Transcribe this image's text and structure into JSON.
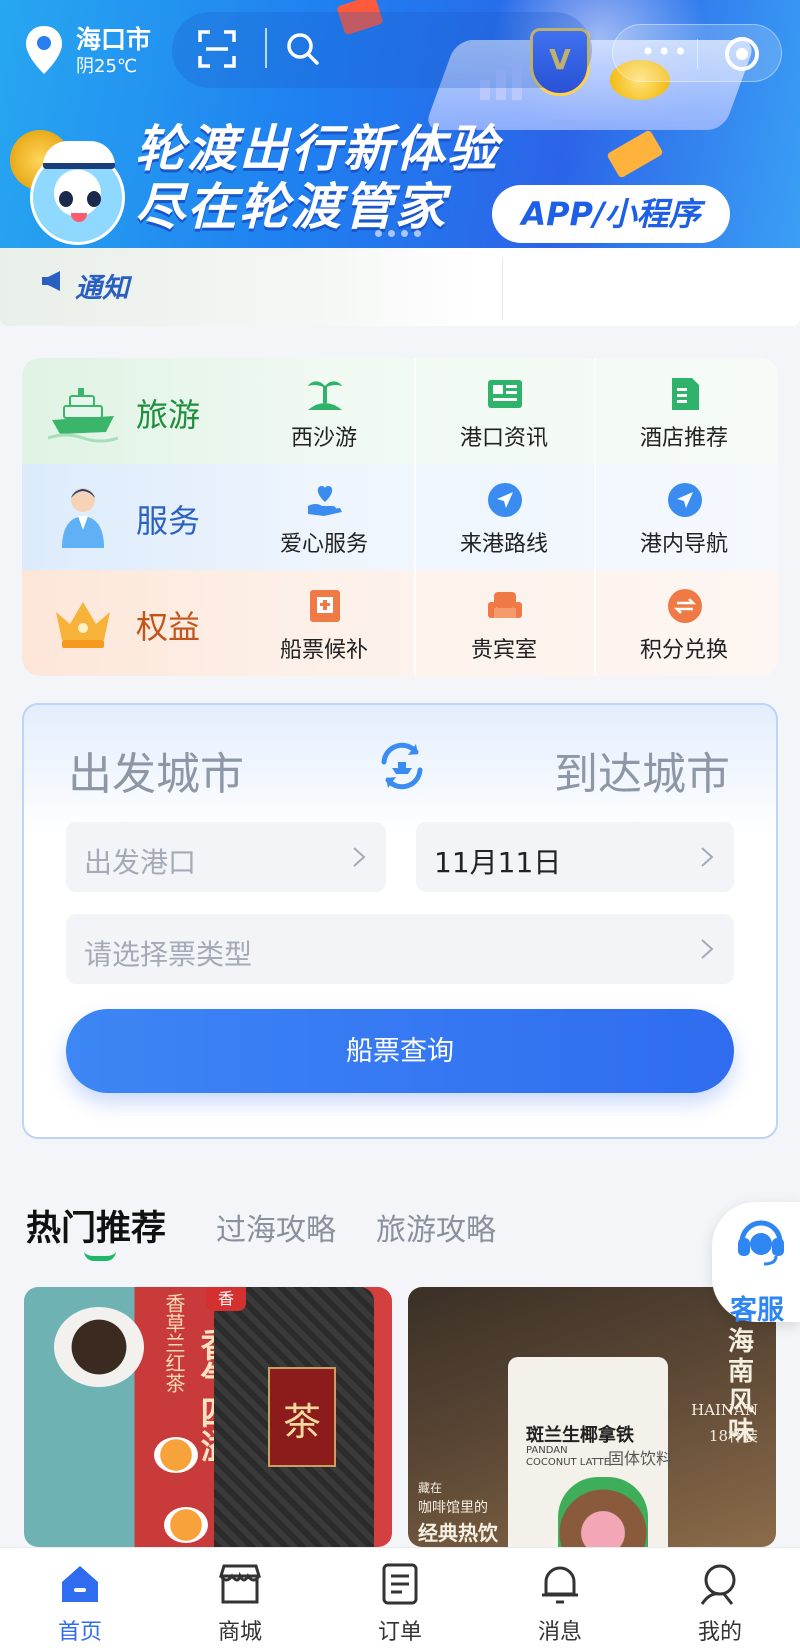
{
  "location": {
    "city": "海口市",
    "weather": "阴25℃"
  },
  "banner": {
    "headline_line1": "轮渡出行新体验",
    "headline_line2": "尽在轮渡管家",
    "pill": "APP/小程序",
    "shield_letter": "V"
  },
  "notice": {
    "label": "通知"
  },
  "categories": [
    {
      "title": "旅游",
      "items": [
        {
          "label": "西沙游",
          "icon": "palm-island-icon"
        },
        {
          "label": "港口资讯",
          "icon": "newspaper-icon"
        },
        {
          "label": "酒店推荐",
          "icon": "document-icon"
        }
      ]
    },
    {
      "title": "服务",
      "items": [
        {
          "label": "爱心服务",
          "icon": "heart-hand-icon"
        },
        {
          "label": "来港路线",
          "icon": "navigation-arrow-icon"
        },
        {
          "label": "港内导航",
          "icon": "navigation-arrow-icon"
        }
      ]
    },
    {
      "title": "权益",
      "items": [
        {
          "label": "船票候补",
          "icon": "ticket-waitlist-icon"
        },
        {
          "label": "贵宾室",
          "icon": "sofa-icon"
        },
        {
          "label": "积分兑换",
          "icon": "exchange-icon"
        }
      ]
    }
  ],
  "booking": {
    "from_city": "出发城市",
    "to_city": "到达城市",
    "port_placeholder": "出发港口",
    "date_value": "11月11日",
    "ticket_type_placeholder": "请选择票类型",
    "query_button": "船票查询"
  },
  "tabs": [
    {
      "label": "热门推荐",
      "active": true
    },
    {
      "label": "过海攻略",
      "active": false
    },
    {
      "label": "旅游攻略",
      "active": false
    }
  ],
  "products": {
    "p1": {
      "can_char": "茶",
      "vertical_small": "香草兰红茶",
      "vertical_big": "香气四溢",
      "badge": "香"
    },
    "p2": {
      "title": "斑兰生椰拿铁",
      "subtitle": "PANDAN COCONUT LATTE",
      "tag": "固体饮料",
      "right_title": "海南风味",
      "right_en": "HAINAN",
      "right_count": "18杯装",
      "note_small": "藏在",
      "note_mid": "咖啡馆里的",
      "note_big": "经典热饮"
    }
  },
  "customer_service": {
    "label": "客服"
  },
  "bottom_nav": [
    {
      "label": "首页",
      "icon": "home-icon",
      "active": true
    },
    {
      "label": "商城",
      "icon": "store-icon",
      "active": false
    },
    {
      "label": "订单",
      "icon": "order-icon",
      "active": false
    },
    {
      "label": "消息",
      "icon": "bell-icon",
      "active": false
    },
    {
      "label": "我的",
      "icon": "user-icon",
      "active": false
    }
  ],
  "colors": {
    "primary": "#2f6cef",
    "green": "#1e8f3c",
    "blue": "#2a62c4",
    "orange": "#c3541a",
    "cs_blue": "#2d86f2"
  }
}
